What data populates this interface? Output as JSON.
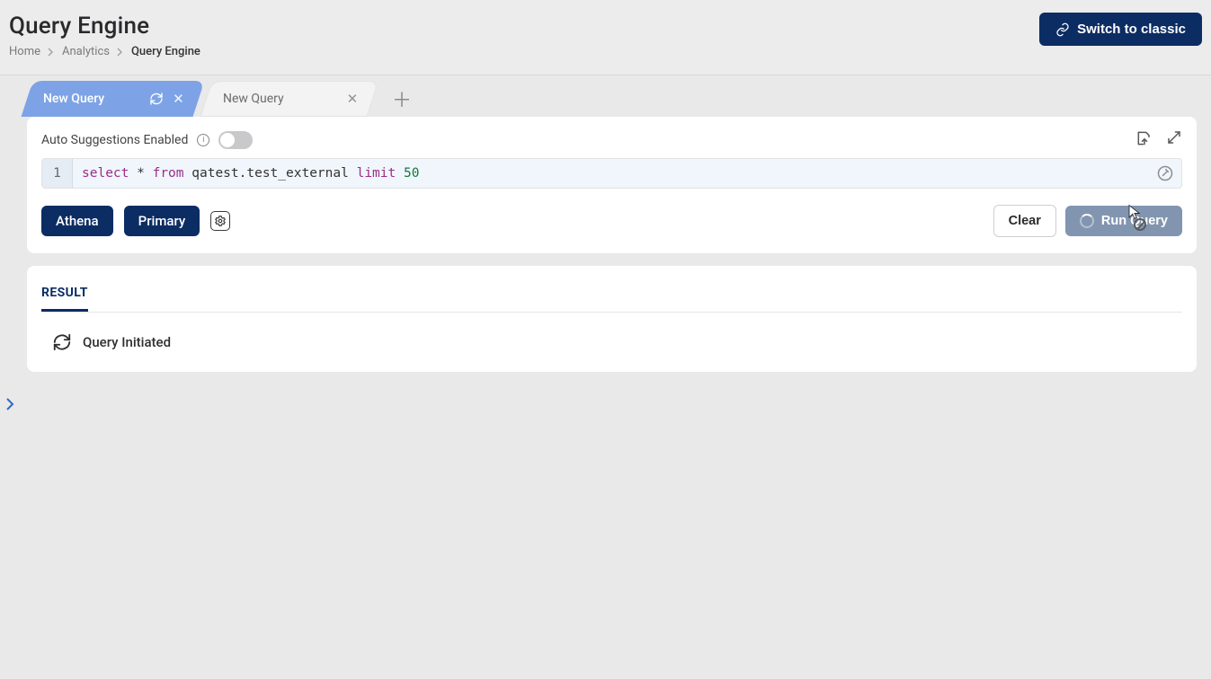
{
  "header": {
    "title": "Query Engine",
    "breadcrumb": [
      "Home",
      "Analytics",
      "Query Engine"
    ],
    "switch_classic_label": "Switch to classic"
  },
  "tabs": {
    "items": [
      {
        "label": "New Query",
        "active": true
      },
      {
        "label": "New Query",
        "active": false
      }
    ]
  },
  "editor": {
    "auto_suggestions_label": "Auto Suggestions Enabled",
    "auto_suggestions_on": false,
    "line_number": "1",
    "sql_tokens": {
      "select": "select",
      "star": "*",
      "from": "from",
      "table": "qatest.test_external",
      "limit": "limit",
      "n": "50"
    },
    "engine_chip": "Athena",
    "context_chip": "Primary",
    "clear_label": "Clear",
    "run_label": "Run Query"
  },
  "result": {
    "tab_label": "RESULT",
    "status_text": "Query Initiated"
  }
}
